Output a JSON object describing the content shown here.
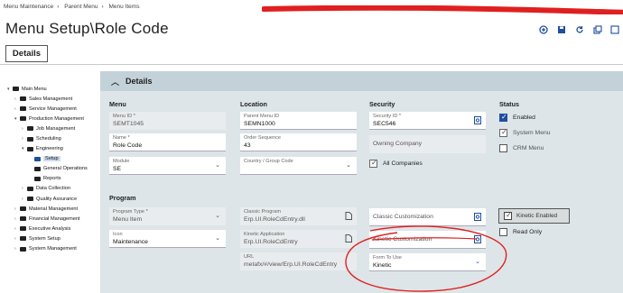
{
  "breadcrumb": [
    "Menu Maintenance",
    "Parent Menu",
    "Menu Items"
  ],
  "page_title": "Menu Setup\\Role Code",
  "toolbar": {
    "icons": [
      "add-new-icon",
      "save-icon",
      "refresh-icon",
      "copy-icon",
      "expand-icon"
    ]
  },
  "tab": {
    "label": "Details"
  },
  "tree": [
    {
      "label": "Main Menu",
      "level": 0,
      "toggle": "▾"
    },
    {
      "label": "Sales Management",
      "level": 1,
      "toggle": "›"
    },
    {
      "label": "Service Management",
      "level": 1,
      "toggle": "›"
    },
    {
      "label": "Production Management",
      "level": 1,
      "toggle": "▾"
    },
    {
      "label": "Job Management",
      "level": 2,
      "toggle": "›"
    },
    {
      "label": "Scheduling",
      "level": 2,
      "toggle": "›"
    },
    {
      "label": "Engineering",
      "level": 2,
      "toggle": "▾"
    },
    {
      "label": "Setup",
      "level": 3,
      "toggle": "",
      "selected": true
    },
    {
      "label": "General Operations",
      "level": 3,
      "toggle": ""
    },
    {
      "label": "Reports",
      "level": 3,
      "toggle": ""
    },
    {
      "label": "Data Collection",
      "level": 2,
      "toggle": "›"
    },
    {
      "label": "Quality Assurance",
      "level": 2,
      "toggle": "›"
    },
    {
      "label": "Material Management",
      "level": 1,
      "toggle": "›"
    },
    {
      "label": "Financial Management",
      "level": 1,
      "toggle": "›"
    },
    {
      "label": "Executive Analysis",
      "level": 1,
      "toggle": "›"
    },
    {
      "label": "System Setup",
      "level": 1,
      "toggle": "›"
    },
    {
      "label": "System Management",
      "level": 1,
      "toggle": "›"
    }
  ],
  "panel": {
    "title": "Details",
    "sections": {
      "menu": "Menu",
      "location": "Location",
      "security": "Security",
      "status": "Status",
      "program": "Program"
    },
    "menu_id": {
      "label": "Menu ID",
      "value": "SEMT1045"
    },
    "name": {
      "label": "Name",
      "value": "Role Code"
    },
    "module": {
      "label": "Module",
      "value": "SE"
    },
    "parent_menu_id": {
      "label": "Parent Menu ID",
      "value": "SEMN1000"
    },
    "order_sequence": {
      "label": "Order Sequence",
      "value": "43"
    },
    "country_group": {
      "label": "Country / Group Code"
    },
    "security_id": {
      "label": "Security ID",
      "value": "SEC546"
    },
    "owning_company": {
      "label": "Owning Company"
    },
    "all_companies": {
      "label": "All Companies",
      "checked": true
    },
    "status_enabled": {
      "label": "Enabled",
      "checked": true
    },
    "status_system_menu": {
      "label": "System Menu",
      "checked": true
    },
    "status_crm_menu": {
      "label": "CRM Menu",
      "checked": false
    },
    "program_type": {
      "label": "Program Type",
      "value": "Menu Item"
    },
    "icon": {
      "label": "Icon",
      "value": "Maintenance"
    },
    "classic_program": {
      "label": "Classic Program",
      "value": "Erp.UI.RoleCdEntry.dll"
    },
    "kinetic_application": {
      "label": "Kinetic Application",
      "value": "Erp.UI.RoleCdEntry"
    },
    "url": {
      "label": "URL",
      "value": "metafx/#/view/Erp.UI.RoleCdEntry"
    },
    "classic_customization": {
      "label": "Classic Customization"
    },
    "kinetic_customization": {
      "label": "Kinetic Customization"
    },
    "form_to_use": {
      "label": "Form To Use",
      "value": "Kinetic"
    },
    "kinetic_enabled": {
      "label": "Kinetic Enabled",
      "checked": true
    },
    "read_only": {
      "label": "Read Only",
      "checked": false
    }
  },
  "colors": {
    "accent": "#1f4e9c",
    "panel_bg": "#dde5e8",
    "panel_header": "#c3d1d8",
    "annotation_red": "#e02020"
  }
}
